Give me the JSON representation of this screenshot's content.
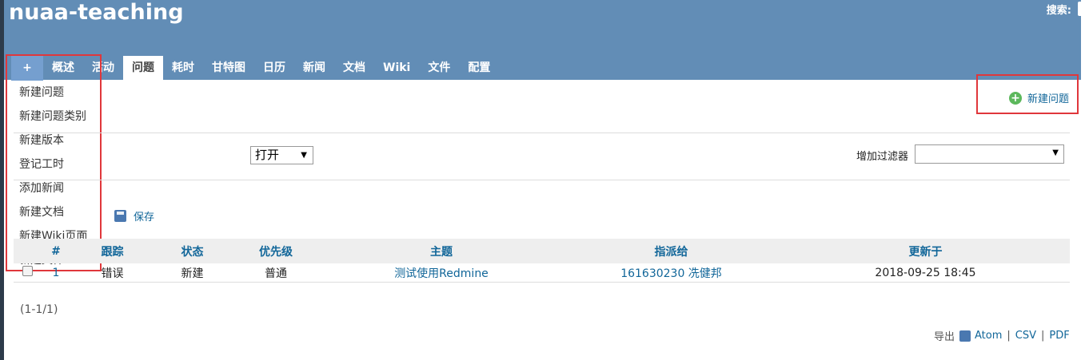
{
  "header": {
    "project_title": "nuaa-teaching",
    "search_label": "搜索:"
  },
  "tabs": [
    {
      "label": "+"
    },
    {
      "label": "概述"
    },
    {
      "label": "活动"
    },
    {
      "label": "问题",
      "selected": true
    },
    {
      "label": "耗时"
    },
    {
      "label": "甘特图"
    },
    {
      "label": "日历"
    },
    {
      "label": "新闻"
    },
    {
      "label": "文档"
    },
    {
      "label": "Wiki"
    },
    {
      "label": "文件"
    },
    {
      "label": "配置"
    }
  ],
  "new_menu": {
    "items": [
      "新建问题",
      "新建问题类别",
      "新建版本",
      "登记工时",
      "添加新闻",
      "新建文档",
      "新建Wiki页面",
      "新建文件"
    ]
  },
  "actions": {
    "new_issue_label": "新建问题",
    "save_label": "保存"
  },
  "filters": {
    "status_value": "打开",
    "add_filter_label": "增加过滤器",
    "add_filter_value": ""
  },
  "issues_table": {
    "headers": [
      "#",
      "跟踪",
      "状态",
      "优先级",
      "主题",
      "指派给",
      "更新于"
    ],
    "rows": [
      {
        "id": "1",
        "tracker": "错误",
        "status": "新建",
        "priority": "普通",
        "subject": "测试使用Redmine",
        "assignee": "161630230 冼健邦",
        "updated": "2018-09-25 18:45"
      }
    ]
  },
  "pagination": "(1-1/1)",
  "export": {
    "label": "导出",
    "atom": "Atom",
    "csv": "CSV",
    "pdf": "PDF"
  },
  "colors": {
    "header_bg": "#628db6",
    "link": "#116699",
    "highlight": "#e0373b"
  }
}
